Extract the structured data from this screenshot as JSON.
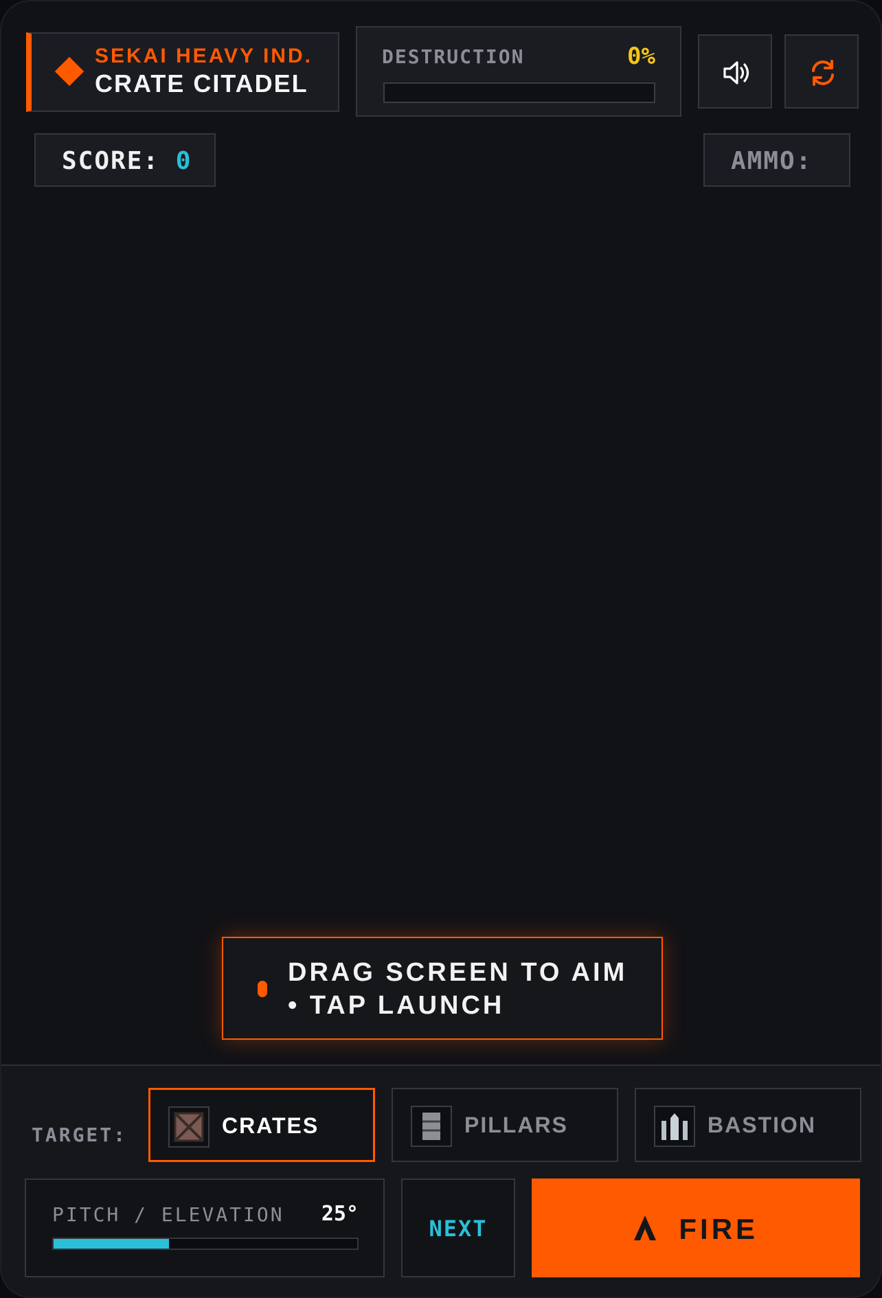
{
  "header": {
    "brand": "SEKAI HEAVY IND.",
    "game_title": "CRATE CITADEL",
    "destruction_label": "DESTRUCTION",
    "destruction_value": "0%",
    "destruction_progress": 0
  },
  "hud": {
    "score_label": "SCORE:",
    "score_value": "0",
    "ammo_label": "AMMO:"
  },
  "buttons": {
    "sound_icon": "speaker-icon",
    "reset_icon": "refresh-icon"
  },
  "hint": {
    "text": "DRAG SCREEN TO AIM • TAP LAUNCH"
  },
  "dock": {
    "target_label": "TARGET:",
    "targets": [
      {
        "label": "CRATES",
        "icon": "crate-icon",
        "active": true
      },
      {
        "label": "PILLARS",
        "icon": "pillar-icon",
        "active": false
      },
      {
        "label": "BASTION",
        "icon": "bastion-icon",
        "active": false
      }
    ],
    "pitch_label": "PITCH / ELEVATION",
    "pitch_value": "25°",
    "pitch_fraction": 0.38,
    "next_label": "NEXT",
    "fire_label": "FIRE"
  },
  "colors": {
    "accent": "#ff5a00",
    "cyan": "#29c0d8",
    "yellow": "#f5c518",
    "background": "#111216"
  }
}
